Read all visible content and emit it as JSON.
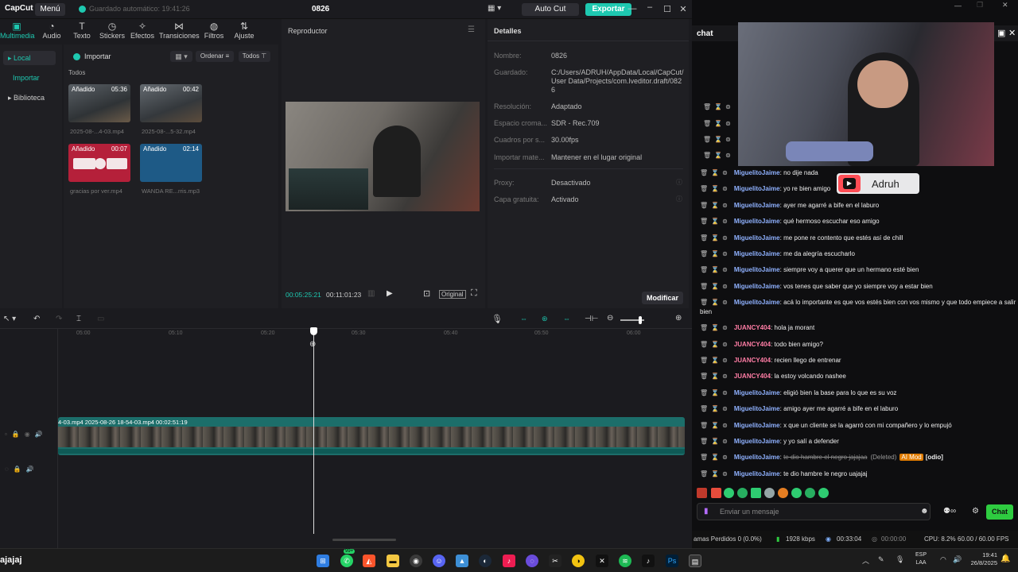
{
  "capcut": {
    "logo": "CapCut",
    "menu": "Menú",
    "autosave": "Guardado automático: 19:41:26",
    "title": "0826",
    "autocut": "Auto Cut",
    "export": "Exportar",
    "tools": [
      "Multimedia",
      "Audio",
      "Texto",
      "Stickers",
      "Efectos",
      "Transiciones",
      "Filtros",
      "Ajuste"
    ],
    "nav": {
      "local": "Local",
      "import": "Importar",
      "library": "Biblioteca"
    },
    "media": {
      "import": "Importar",
      "sort": "Ordenar",
      "all_filter": "Todos",
      "all_label": "Todos",
      "items": [
        {
          "tag": "Añadido",
          "duration": "05:36",
          "caption": "2025-08-...4-03.mp4"
        },
        {
          "tag": "Añadido",
          "duration": "00:42",
          "caption": "2025-08-...5-32.mp4"
        },
        {
          "tag": "Añadido",
          "duration": "00:07",
          "caption": "gracias por ver.mp4"
        },
        {
          "tag": "Añadido",
          "duration": "02:14",
          "caption": "WANDA RE...rris.mp3"
        }
      ]
    },
    "player": {
      "title": "Reproductor",
      "current": "00:05:25:21",
      "total": "00:11:01:23",
      "original": "Original"
    },
    "details": {
      "title": "Detalles",
      "rows": [
        {
          "label": "Nombre:",
          "value": "0826"
        },
        {
          "label": "Guardado:",
          "value": "C:/Users/ADRUH/AppData/Local/CapCut/User Data/Projects/com.lveditor.draft/0826"
        },
        {
          "label": "Resolución:",
          "value": "Adaptado"
        },
        {
          "label": "Espacio croma...",
          "value": "SDR - Rec.709"
        },
        {
          "label": "Cuadros por s...",
          "value": "30.00fps"
        },
        {
          "label": "Importar mate...",
          "value": "Mantener en el lugar original"
        },
        {
          "label": "Proxy:",
          "value": "Desactivado"
        },
        {
          "label": "Capa gratuita:",
          "value": "Activado"
        }
      ],
      "modify": "Modificar"
    },
    "timeline": {
      "ticks": [
        "05:00",
        "05:10",
        "05:20",
        "05:30",
        "05:40",
        "05:50",
        "06:00"
      ],
      "clip_label": "4-03.mp4  2025-08-26 18-54-03.mp4  00:02:51:19"
    }
  },
  "chat": {
    "title": "chat",
    "streamer_badge": "Adruh",
    "messages": [
      {
        "user": "MiguelitoJaime",
        "text": "no dije nada",
        "color": "u1"
      },
      {
        "user": "MiguelitoJaime",
        "text": "yo re bien amigo",
        "color": "u1"
      },
      {
        "user": "MiguelitoJaime",
        "text": "ayer me agarré a bife en el laburo",
        "color": "u1"
      },
      {
        "user": "MiguelitoJaime",
        "text": "qué hermoso escuchar eso amigo",
        "color": "u1"
      },
      {
        "user": "MiguelitoJaime",
        "text": "me pone re contento que estés así de chill",
        "color": "u1"
      },
      {
        "user": "MiguelitoJaime",
        "text": "me da alegría escucharlo",
        "color": "u1"
      },
      {
        "user": "MiguelitoJaime",
        "text": "siempre voy a querer que un hermano esté bien",
        "color": "u1"
      },
      {
        "user": "MiguelitoJaime",
        "text": "vos tenes que saber que yo siempre voy a estar bien",
        "color": "u1"
      },
      {
        "user": "MiguelitoJaime",
        "text": "acá lo importante es que vos estés bien con vos mismo y que todo empiece a salir",
        "color": "u1"
      },
      {
        "user": "JUANCY404",
        "text": "hola ja morant",
        "color": "u2"
      },
      {
        "user": "JUANCY404",
        "text": "todo bien amigo?",
        "color": "u2"
      },
      {
        "user": "JUANCY404",
        "text": "recien llego de entrenar",
        "color": "u2"
      },
      {
        "user": "JUANCY404",
        "text": "la estoy volcando nashee",
        "color": "u2"
      },
      {
        "user": "MiguelitoJaime",
        "text": "eligió bien la base para lo que es su voz",
        "color": "u1"
      },
      {
        "user": "MiguelitoJaime",
        "text": "amigo ayer me agarré a bife en el laburo",
        "color": "u1"
      },
      {
        "user": "MiguelitoJaime",
        "text": "x que un cliente se la agarró con mi compañero y lo empujó",
        "color": "u1"
      },
      {
        "user": "MiguelitoJaime",
        "text": "y yo salí a defender",
        "color": "u1"
      },
      {
        "user": "MiguelitoJaime",
        "text": "te dio hambre el negro jajajaa",
        "color": "u1"
      },
      {
        "user": "MiguelitoJaime",
        "text": "te dio hambre le negro uajajaj",
        "color": "u1"
      }
    ],
    "wrap_text": "bien",
    "deleted_tag": "(Deleted)",
    "ai_mod": "AI Mod",
    "odio": "[odio]",
    "input_placeholder": "Enviar un mensaje",
    "chat_button": "Chat"
  },
  "status": {
    "frames": "amas Perdidos 0 (0.0%)",
    "bitrate": "1928 kbps",
    "stream_time": "00:33:04",
    "rec_time": "00:00:00",
    "cpu": "CPU: 8.2%",
    "fps": "60.00 / 60.00 FPS"
  },
  "taskbar": {
    "left_text": "ajajaj",
    "badge": "99+",
    "lang": "ESP",
    "lang2": "LAA",
    "time": "19:41",
    "date": "26/8/2025"
  },
  "colors": {
    "accent": "#1ec8b0",
    "chat_green": "#2ecc40"
  }
}
